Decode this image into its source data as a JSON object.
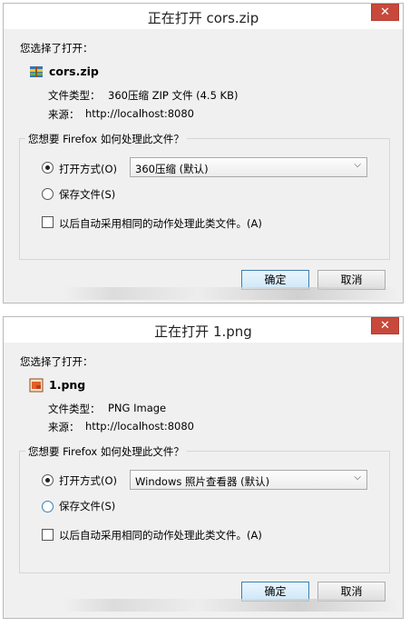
{
  "dialogs": [
    {
      "title": "正在打开 cors.zip",
      "intro": "您选择了打开：",
      "file_name": "cors.zip",
      "file_icon": "archive-icon",
      "file_type_label": "文件类型：",
      "file_type": "360压缩 ZIP 文件 (4.5 KB)",
      "source_label": "来源：",
      "source": "http://localhost:8080",
      "question": "您想要 Firefox 如何处理此文件？",
      "open_with_label": "打开方式(O)",
      "open_with_value": "360压缩 (默认)",
      "save_file_label": "保存文件(S)",
      "auto_label": "以后自动采用相同的动作处理此类文件。(A)",
      "ok_label": "确定",
      "cancel_label": "取消",
      "selected": "open_with"
    },
    {
      "title": "正在打开 1.png",
      "intro": "您选择了打开：",
      "file_name": "1.png",
      "file_icon": "image-icon",
      "file_type_label": "文件类型：",
      "file_type": "PNG Image",
      "source_label": "来源：",
      "source": "http://localhost:8080",
      "question": "您想要 Firefox 如何处理此文件？",
      "open_with_label": "打开方式(O)",
      "open_with_value": "Windows 照片查看器 (默认)",
      "save_file_label": "保存文件(S)",
      "auto_label": "以后自动采用相同的动作处理此类文件。(A)",
      "ok_label": "确定",
      "cancel_label": "取消",
      "selected": "open_with"
    }
  ],
  "colors": {
    "close_button": "#c7493c",
    "default_button_border": "#3c7fb1",
    "dialog_bg": "#f0f0f0"
  }
}
